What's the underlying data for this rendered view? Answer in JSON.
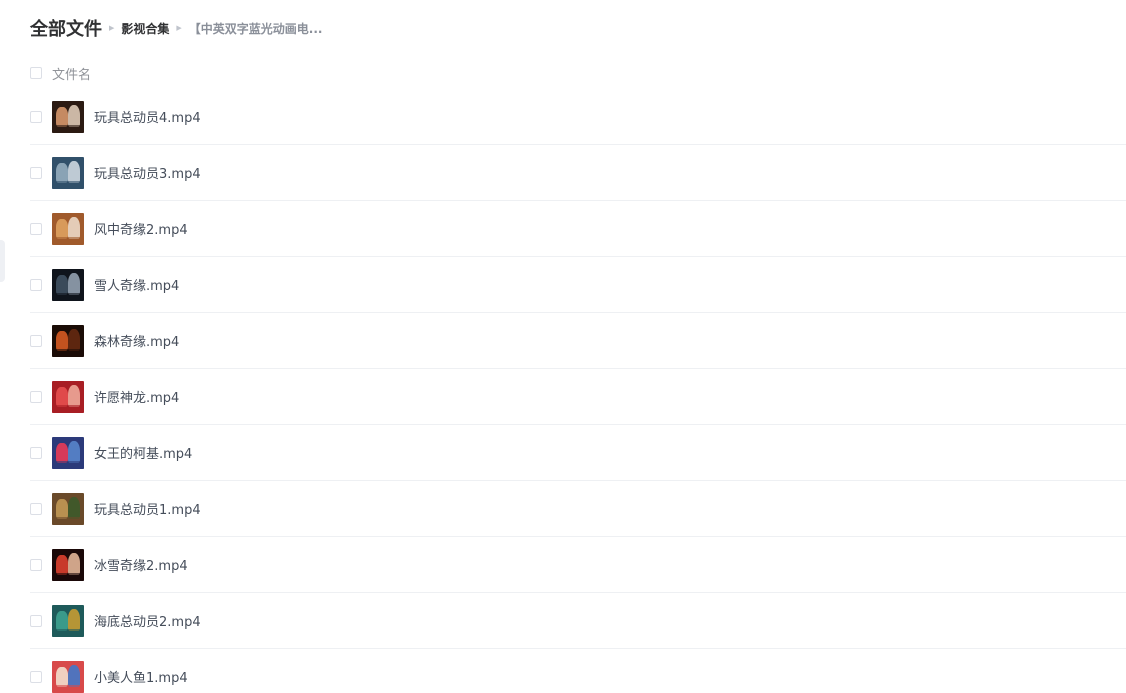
{
  "breadcrumb": {
    "root": "全部文件",
    "middle": "影视合集",
    "current": "【中英双字蓝光动画电..."
  },
  "list_header": {
    "filename_label": "文件名"
  },
  "files": [
    {
      "name": "玩具总动员4.mp4",
      "thumb": [
        "#2b1a12",
        "#c58a62",
        "#e8d4c0"
      ]
    },
    {
      "name": "玩具总动员3.mp4",
      "thumb": [
        "#31506a",
        "#8aa3b5",
        "#d7dfe6"
      ]
    },
    {
      "name": "风中奇缘2.mp4",
      "thumb": [
        "#a05a2c",
        "#d89a5a",
        "#f0e0d0"
      ]
    },
    {
      "name": "雪人奇缘.mp4",
      "thumb": [
        "#0f141c",
        "#3a4a5a",
        "#9aa8b8"
      ]
    },
    {
      "name": "森林奇缘.mp4",
      "thumb": [
        "#1a0c06",
        "#c2521f",
        "#6a2c12"
      ]
    },
    {
      "name": "许愿神龙.mp4",
      "thumb": [
        "#a81e24",
        "#e04a4a",
        "#f2b0a0"
      ]
    },
    {
      "name": "女王的柯基.mp4",
      "thumb": [
        "#2c3a7a",
        "#d63a5a",
        "#5a8ad0"
      ]
    },
    {
      "name": "玩具总动员1.mp4",
      "thumb": [
        "#6a4a2a",
        "#b89050",
        "#3a5a2a"
      ]
    },
    {
      "name": "冰雪奇缘2.mp4",
      "thumb": [
        "#1a0808",
        "#c83a2a",
        "#f0c0a0"
      ]
    },
    {
      "name": "海底总动员2.mp4",
      "thumb": [
        "#1e5a5a",
        "#3a9a8a",
        "#d0a030"
      ]
    },
    {
      "name": "小美人鱼1.mp4",
      "thumb": [
        "#d84a4a",
        "#f0d0c0",
        "#3a7ad0"
      ]
    }
  ]
}
